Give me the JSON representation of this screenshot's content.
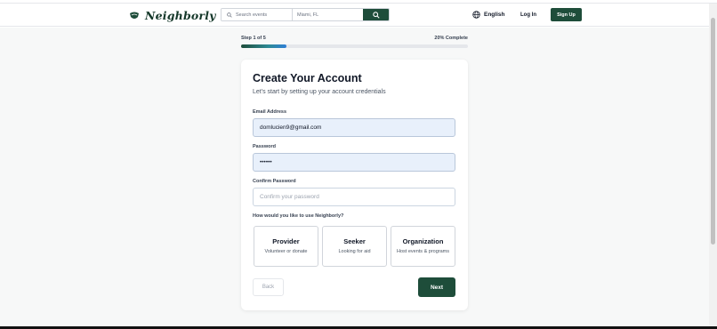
{
  "header": {
    "logo_text": "Neighborly",
    "search_placeholder": "Search events",
    "location_value": "Miami, FL",
    "language": "English",
    "login_label": "Log In",
    "signup_label": "Sign Up"
  },
  "progress": {
    "step_label": "Step 1 of 5",
    "complete_label": "20% Complete",
    "fraction": 0.2
  },
  "form": {
    "title": "Create Your Account",
    "subtitle": "Let's start by setting up your account credentials",
    "email_label": "Email Address",
    "email_value": "domlucien9@gmail.com",
    "password_label": "Password",
    "password_value": "••••••",
    "confirm_label": "Confirm Password",
    "confirm_placeholder": "Confirm your password",
    "role_question": "How would you like to use Neighborly?",
    "roles": [
      {
        "name": "Provider",
        "desc": "Volunteer or donate"
      },
      {
        "name": "Seeker",
        "desc": "Looking for aid"
      },
      {
        "name": "Organization",
        "desc": "Host events & programs"
      }
    ],
    "back_label": "Back",
    "next_label": "Next"
  },
  "colors": {
    "brand": "#1e4d3a",
    "filled_input": "#e8f0fb"
  },
  "icons": [
    "logo-icon",
    "search-icon",
    "globe-icon"
  ]
}
